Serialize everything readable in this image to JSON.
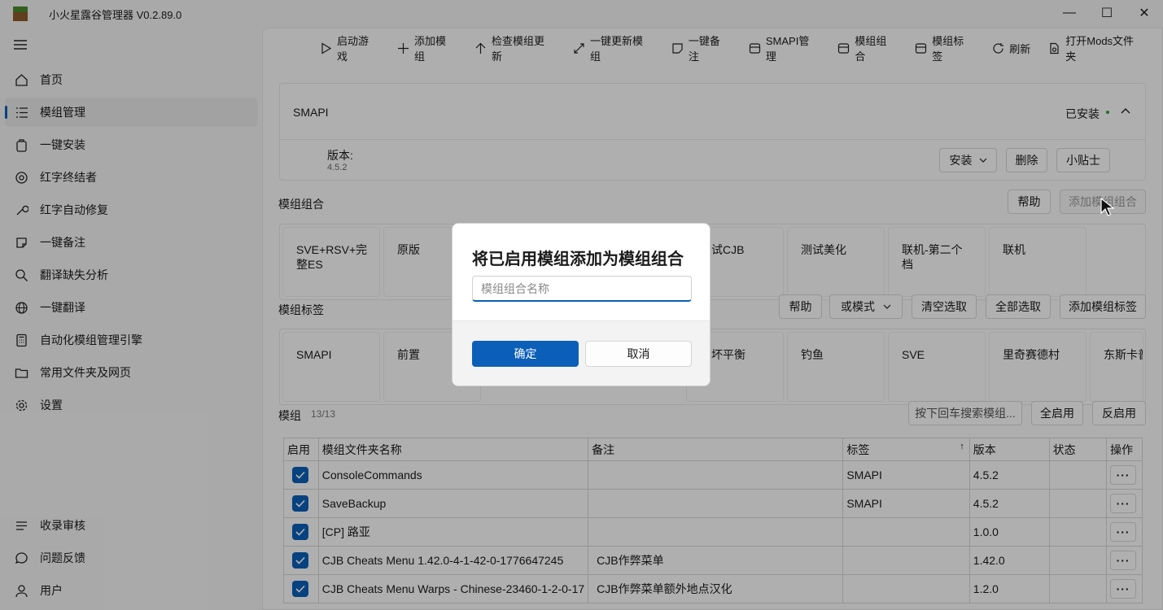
{
  "app": {
    "title": "小火星露谷管理器 V0.2.89.0",
    "minimize_glyph": "—",
    "maximize_glyph": "☐",
    "close_glyph": "✕"
  },
  "sidebar": {
    "items": [
      {
        "label": "首页",
        "icon": "home-icon"
      },
      {
        "label": "模组管理",
        "icon": "list-icon"
      },
      {
        "label": "一键安装",
        "icon": "package-icon"
      },
      {
        "label": "红字终结者",
        "icon": "target-icon"
      },
      {
        "label": "红字自动修复",
        "icon": "wrench-icon"
      },
      {
        "label": "一键备注",
        "icon": "note-icon"
      },
      {
        "label": "翻译缺失分析",
        "icon": "search-icon"
      },
      {
        "label": "一键翻译",
        "icon": "globe-icon"
      },
      {
        "label": "自动化模组管理引擎",
        "icon": "calculator-icon"
      },
      {
        "label": "常用文件夹及网页",
        "icon": "folder-icon"
      },
      {
        "label": "设置",
        "icon": "gear-icon"
      }
    ],
    "bottom_items": [
      {
        "label": "收录审核",
        "icon": "list-icon"
      },
      {
        "label": "问题反馈",
        "icon": "chat-icon"
      },
      {
        "label": "用户",
        "icon": "user-icon"
      }
    ]
  },
  "toolbar": {
    "items": [
      {
        "label": "启动游戏",
        "icon": "play-icon"
      },
      {
        "label": "添加模组",
        "icon": "plus-icon"
      },
      {
        "label": "检查模组更新",
        "icon": "arrow-up-icon"
      },
      {
        "label": "一键更新模组",
        "icon": "link-icon"
      },
      {
        "label": "一键备注",
        "icon": "note-icon"
      },
      {
        "label": "SMAPI管理",
        "icon": "database-icon"
      },
      {
        "label": "模组组合",
        "icon": "database-icon"
      },
      {
        "label": "模组标签",
        "icon": "database-icon"
      },
      {
        "label": "刷新",
        "icon": "refresh-icon"
      },
      {
        "label": "打开Mods文件夹",
        "icon": "folder-link-icon"
      }
    ]
  },
  "smapi": {
    "name": "SMAPI",
    "status": "已安装",
    "version_label": "版本:",
    "version_value": "4.5.2",
    "install_button": "安装",
    "delete_button": "删除",
    "tips_button": "小贴士"
  },
  "combos": {
    "title": "模组组合",
    "help_button": "帮助",
    "add_button": "添加模组组合",
    "items": [
      "SVE+RSV+完整ES",
      "原版",
      "试CJB",
      "测试美化",
      "联机-第二个档",
      "联机"
    ]
  },
  "tags": {
    "title": "模组标签",
    "help_button": "帮助",
    "mode_button": "或模式",
    "clear_button": "清空选取",
    "select_all_button": "全部选取",
    "add_button": "添加模组标签",
    "items": [
      "SMAPI",
      "前置",
      "坏平衡",
      "钓鱼",
      "SVE",
      "里奇赛德村",
      "东斯卡普"
    ]
  },
  "mods": {
    "title": "模组",
    "count": "13/13",
    "search_placeholder": "按下回车搜索模组...",
    "enable_all_button": "全启用",
    "invert_button": "反启用",
    "columns": {
      "enabled": "启用",
      "folder": "模组文件夹名称",
      "note": "备注",
      "tags": "标签",
      "sort_glyph": "↑",
      "version": "版本",
      "status": "状态",
      "actions": "操作"
    },
    "rows": [
      {
        "folder": "ConsoleCommands",
        "note": "",
        "tags": "SMAPI",
        "version": "4.5.2"
      },
      {
        "folder": "SaveBackup",
        "note": "",
        "tags": "SMAPI",
        "version": "4.5.2"
      },
      {
        "folder": "[CP] 路亚",
        "note": "",
        "tags": "",
        "version": "1.0.0"
      },
      {
        "folder": "CJB Cheats Menu 1.42.0-4-1-42-0-1776647245",
        "note": "CJB作弊菜单",
        "tags": "",
        "version": "1.42.0"
      },
      {
        "folder": "CJB Cheats Menu Warps - Chinese-23460-1-2-0-17",
        "note": "CJB作弊菜单额外地点汉化",
        "tags": "",
        "version": "1.2.0"
      }
    ],
    "more_glyph": "···"
  },
  "dialog": {
    "title": "将已启用模组添加为模组组合",
    "input_value": "",
    "input_placeholder": "模组组合名称",
    "ok_button": "确定",
    "cancel_button": "取消"
  },
  "colors": {
    "accent": "#0b5fb8",
    "status_dot": "#2e9e3f"
  }
}
